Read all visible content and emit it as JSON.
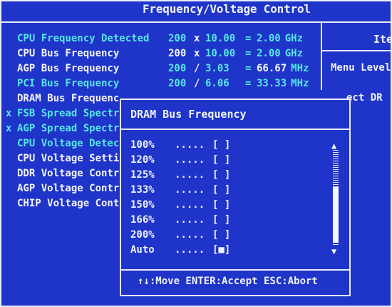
{
  "window": {
    "title": "Frequency/Voltage Control"
  },
  "help": {
    "title_partial": "Ite",
    "menu_level_partial": "Menu Level",
    "select_partial": "ect DR"
  },
  "settings": [
    {
      "mark": "",
      "label": "CPU Frequency Detected",
      "v1": "200",
      "op1": "x",
      "v2": "10.00",
      "op2": "=",
      "v3": "2.00",
      "unit": "GHz",
      "style": "cyan"
    },
    {
      "mark": "",
      "label": "CPU Bus Frequency",
      "v1": "200",
      "op1": "x",
      "v2": "10.00",
      "op2": "=",
      "v3": "2.00",
      "unit": "GHz",
      "style": "white"
    },
    {
      "mark": "",
      "label": "AGP Bus Frequency",
      "v1": "200",
      "op1": "/",
      "v2": "3.03",
      "op2": "=",
      "v3": "66.67",
      "unit": "MHz",
      "style": "white"
    },
    {
      "mark": "",
      "label": "PCI Bus Frequency",
      "v1": "200",
      "op1": "/",
      "v2": "6.06",
      "op2": "=",
      "v3": "33.33",
      "unit": "MHz",
      "style": "cyan"
    },
    {
      "mark": "",
      "label": "DRAM Bus Frequenc",
      "style": "white"
    },
    {
      "mark": "x",
      "label": "FSB Spread Spectr",
      "style": "cyan"
    },
    {
      "mark": "x",
      "label": "AGP Spread Spectr",
      "style": "cyan"
    },
    {
      "mark": "",
      "label": "CPU Voltage Detec",
      "style": "cyan"
    },
    {
      "mark": "",
      "label": "CPU Voltage Setti",
      "style": "white"
    },
    {
      "mark": "",
      "label": "DDR Voltage Contr",
      "style": "white"
    },
    {
      "mark": "",
      "label": "AGP Voltage Contr",
      "style": "white"
    },
    {
      "mark": "",
      "label": "CHIP Voltage Cont",
      "style": "white"
    }
  ],
  "popup": {
    "title": "DRAM Bus Frequency",
    "options": [
      {
        "label": "100%",
        "dots": ".....",
        "box": "[ ]"
      },
      {
        "label": "120%",
        "dots": ".....",
        "box": "[ ]"
      },
      {
        "label": "125%",
        "dots": ".....",
        "box": "[ ]"
      },
      {
        "label": "133%",
        "dots": ".....",
        "box": "[ ]"
      },
      {
        "label": "150%",
        "dots": ".....",
        "box": "[ ]"
      },
      {
        "label": "166%",
        "dots": ".....",
        "box": "[ ]"
      },
      {
        "label": "200%",
        "dots": ".....",
        "box": "[ ]"
      },
      {
        "label": "Auto",
        "dots": ".....",
        "box": "[■]"
      }
    ],
    "footer": "↑↓:Move ENTER:Accept ESC:Abort",
    "scroll_up": "▲",
    "scroll_down": "▼"
  },
  "colors": {
    "background": "#1f34c8",
    "frame": "#e9eef7",
    "label_cyan": "#56e6e9",
    "label_white": "#f2f5ff"
  }
}
